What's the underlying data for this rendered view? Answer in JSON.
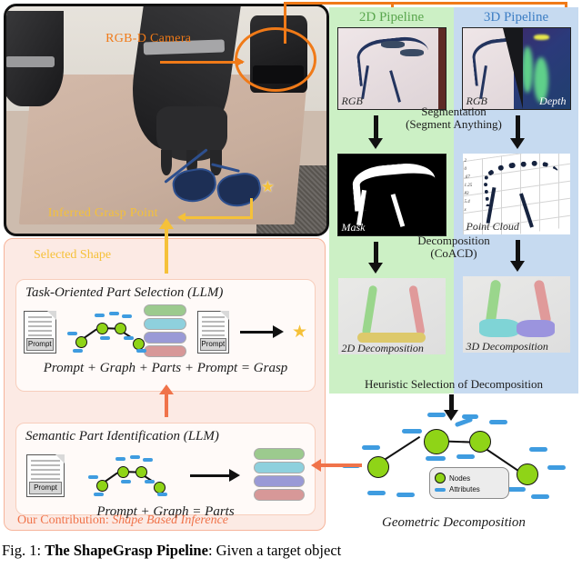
{
  "figure": {
    "caption_prefix": "Fig. 1:",
    "caption_bold": "The ShapeGrasp Pipeline",
    "caption_rest": ": Given a target object"
  },
  "photo": {
    "camera_label": "RGB-D Camera",
    "grasp_label": "Inferred Grasp Point"
  },
  "pipelines": {
    "two_d": {
      "title": "2D Pipeline",
      "accent": "#5aa64e",
      "panel_bg": "#ccf0c5",
      "rgb_caption": "RGB",
      "mask_caption": "Mask",
      "decomposition_caption": "2D Decomposition"
    },
    "three_d": {
      "title": "3D Pipeline",
      "accent": "#3d7ec4",
      "panel_bg": "#c6daf0",
      "rgb_caption": "RGB",
      "depth_caption": "Depth",
      "point_cloud_caption": "Point Cloud",
      "decomposition_caption": "3D Decomposition"
    },
    "step_segmentation_line1": "Segmentation",
    "step_segmentation_line2": "(Segment Anything)",
    "step_decomposition_line1": "Decomposition",
    "step_decomposition_line2": "(CoACD)",
    "heuristic_label": "Heuristic Selection of Decomposition",
    "point_cloud_ticks": [
      "2",
      "0",
      ".67",
      "1.25",
      "83",
      "5.4",
      "x",
      "48"
    ]
  },
  "contribution": {
    "selected_shape_label": "Selected Shape",
    "task_box": {
      "title": "Task-Oriented Part Selection (LLM)",
      "equation": "Prompt + Graph + Parts + Prompt = Grasp",
      "doc_tag": "Prompt",
      "doc_tag_2": "Prompt",
      "star": "★"
    },
    "semantic_box": {
      "title": "Semantic Part Identification (LLM)",
      "equation": "Prompt + Graph = Parts",
      "doc_tag": "Prompt"
    },
    "footer_prefix": "Our Contribution: ",
    "footer_italic": "Shape Based Inference",
    "footer_color": "#f0734a",
    "part_colors": [
      "#9cca8e",
      "#8ed0dd",
      "#9a9ad6",
      "#d79898"
    ]
  },
  "geometric": {
    "caption": "Geometric Decomposition",
    "legend": {
      "nodes_label": "Nodes",
      "attributes_label": "Attributes"
    },
    "node_color": "#8fd417",
    "attribute_color": "#3f9ce0"
  },
  "colors": {
    "orange_route": "#f07a18",
    "yellow_arrow": "#f5c139",
    "pink_panel": "#fceae4",
    "salmon_arrow": "#f0734a"
  }
}
